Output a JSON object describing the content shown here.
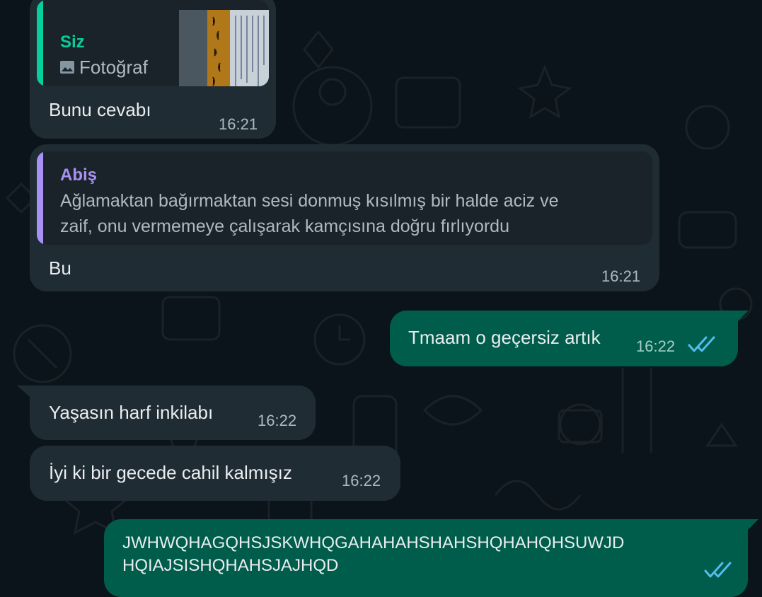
{
  "colors": {
    "background": "#0b141a",
    "incoming_bubble": "#202c33",
    "outgoing_bubble": "#005c4b",
    "quote_you_accent": "#06cf9c",
    "quote_other_accent": "#a791f5",
    "read_ticks": "#53bdeb"
  },
  "messages": [
    {
      "quote": {
        "author": "Siz",
        "icon": "photo-icon",
        "text": "Fotoğraf"
      },
      "text": "Bunu cevabı",
      "time": "16:21"
    },
    {
      "quote": {
        "author": "Abiş",
        "line1": "Ağlamaktan bağırmaktan sesi donmuş kısılmış bir halde aciz ve",
        "line2": "zaif, onu vermemeye çalışarak kamçısına doğru fırlıyordu"
      },
      "text": "Bu",
      "time": "16:21"
    },
    {
      "text": "Tmaam o geçersiz artık",
      "time": "16:22",
      "status_icon": "double-check-icon"
    },
    {
      "text": "Yaşasın harf inkilabı",
      "time": "16:22"
    },
    {
      "text": "İyi ki bir gecede cahil kalmışız",
      "time": "16:22"
    },
    {
      "line1": "JWHWQHAGQHSJSKWHQGAHAHAHSHAHSHQHAHQHSUWJD",
      "line2": "HQIAJSISHQHAHSJAJHQD"
    }
  ]
}
